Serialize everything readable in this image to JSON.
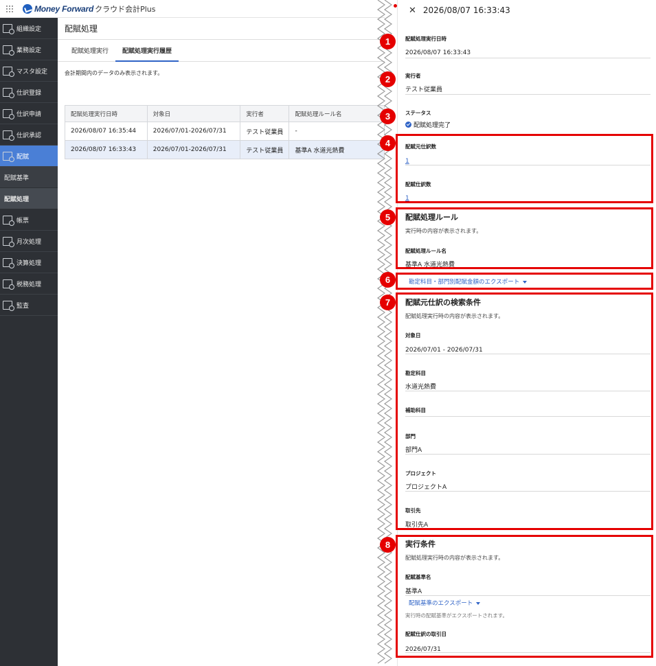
{
  "app": {
    "brand": "Money Forward",
    "product": "クラウド会計Plus"
  },
  "sidebar": {
    "items": [
      {
        "label": "組織設定",
        "icon": "org-settings-icon"
      },
      {
        "label": "業務設定",
        "icon": "business-settings-icon"
      },
      {
        "label": "マスタ設定",
        "icon": "master-settings-icon"
      },
      {
        "label": "仕訳登録",
        "icon": "journal-entry-icon"
      },
      {
        "label": "仕訳申請",
        "icon": "journal-request-icon"
      },
      {
        "label": "仕訳承認",
        "icon": "journal-approval-icon"
      },
      {
        "label": "配賦",
        "icon": "allocation-icon",
        "active": true
      }
    ],
    "subitems": [
      {
        "label": "配賦基準"
      },
      {
        "label": "配賦処理",
        "current": true
      }
    ],
    "items_after": [
      {
        "label": "帳票",
        "icon": "reports-icon"
      },
      {
        "label": "月次処理",
        "icon": "monthly-icon"
      },
      {
        "label": "決算処理",
        "icon": "closing-icon"
      },
      {
        "label": "税務処理",
        "icon": "tax-icon"
      },
      {
        "label": "監査",
        "icon": "audit-icon"
      }
    ]
  },
  "main": {
    "title": "配賦処理",
    "tabs": [
      {
        "label": "配賦処理実行",
        "active": false
      },
      {
        "label": "配賦処理実行履歴",
        "active": true
      }
    ],
    "note": "会計期間内のデータのみ表示されます。",
    "table": {
      "headers": [
        "配賦処理実行日時",
        "対象日",
        "実行者",
        "配賦処理ルール名"
      ],
      "rows": [
        [
          "2026/08/07 16:35:44",
          "2026/07/01-2026/07/31",
          "テスト従業員",
          "-"
        ],
        [
          "2026/08/07 16:33:43",
          "2026/07/01-2026/07/31",
          "テスト従業員",
          "基準A 水道光熱費"
        ]
      ]
    }
  },
  "panel": {
    "title": "2026/08/07 16:33:43",
    "exec_datetime": {
      "label": "配賦処理実行日時",
      "value": "2026/08/07 16:33:43"
    },
    "executor": {
      "label": "実行者",
      "value": "テスト従業員"
    },
    "status": {
      "label": "ステータス",
      "value": "配賦処理完了"
    },
    "source_count": {
      "label": "配賦元仕訳数",
      "value": "1"
    },
    "alloc_count": {
      "label": "配賦仕訳数",
      "value": "1"
    },
    "rule": {
      "title": "配賦処理ルール",
      "desc": "実行時の内容が表示されます。",
      "name_label": "配賦処理ルール名",
      "name_value": "基準A 水道光熱費"
    },
    "export_amounts": "勘定科目・部門別配賦金額のエクスポート",
    "search": {
      "title": "配賦元仕訳の検索条件",
      "desc": "配賦処理実行時の内容が表示されます。",
      "fields": [
        {
          "label": "対象日",
          "value": "2026/07/01 - 2026/07/31"
        },
        {
          "label": "勘定科目",
          "value": "水道光熱費"
        },
        {
          "label": "補助科目",
          "value": ""
        },
        {
          "label": "部門",
          "value": "部門A"
        },
        {
          "label": "プロジェクト",
          "value": "プロジェクトA"
        },
        {
          "label": "取引先",
          "value": "取引先A"
        }
      ]
    },
    "exec_cond": {
      "title": "実行条件",
      "desc": "配賦処理実行時の内容が表示されます。",
      "basis_label": "配賦基準名",
      "basis_value": "基準A",
      "export_basis": "配賦基準のエクスポート",
      "export_note": "実行時の配賦基準がエクスポートされます。",
      "date_label": "配賦仕訳の取引日",
      "date_value": "2026/07/31"
    }
  },
  "badges": [
    "1",
    "2",
    "3",
    "4",
    "5",
    "6",
    "7",
    "8"
  ],
  "colors": {
    "annotation_red": "#e50000",
    "link_blue": "#2f63c6",
    "sidebar_bg": "#2d3035",
    "active_nav": "#4a7fd6"
  }
}
